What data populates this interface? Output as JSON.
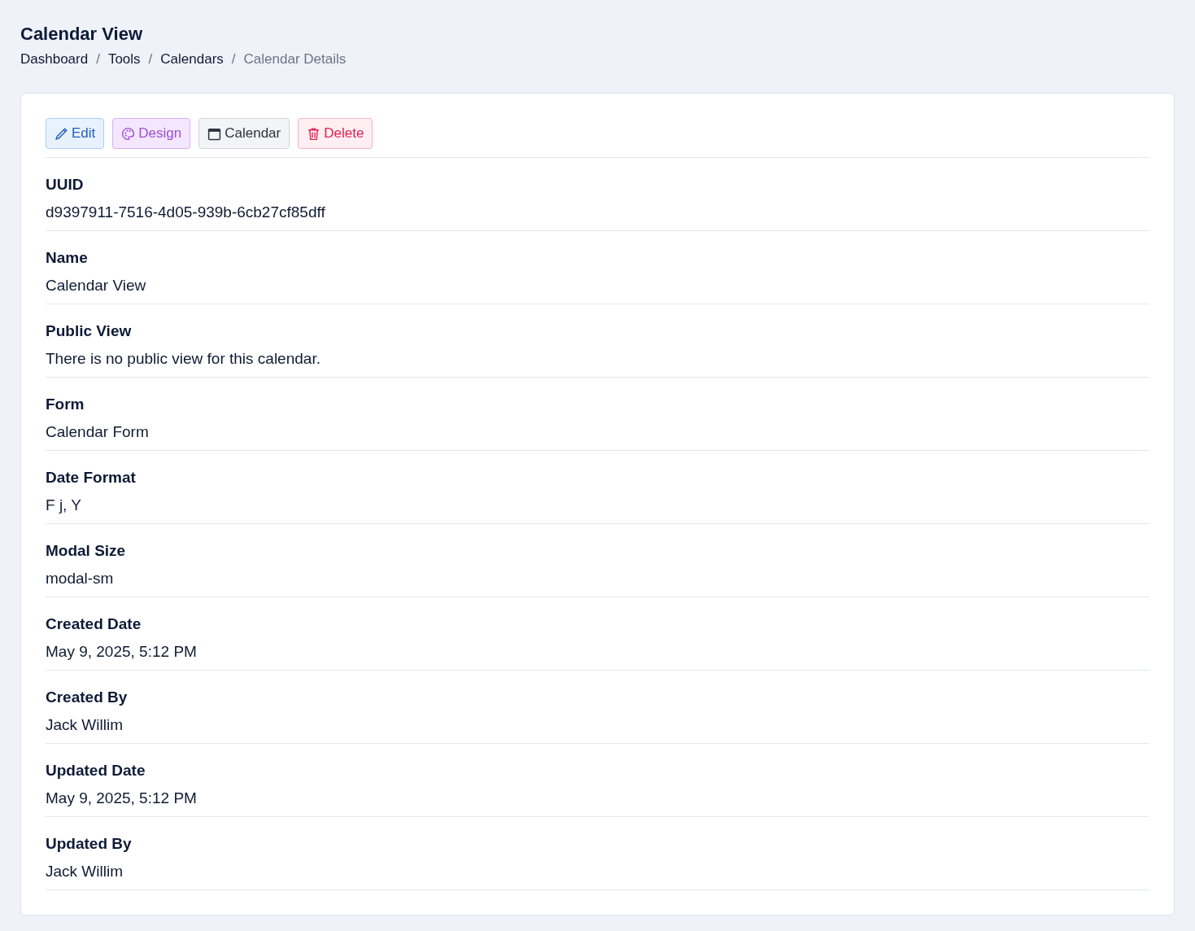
{
  "page_title": "Calendar View",
  "breadcrumb": [
    {
      "label": "Dashboard",
      "current": false
    },
    {
      "separator": "/"
    },
    {
      "label": "Tools",
      "current": false
    },
    {
      "separator": "/"
    },
    {
      "label": "Calendars",
      "current": false
    },
    {
      "separator": "/"
    },
    {
      "label": "Calendar Details",
      "current": true
    }
  ],
  "actions": [
    {
      "kind": "edit",
      "label": "Edit"
    },
    {
      "kind": "design",
      "label": "Design"
    },
    {
      "kind": "calendar",
      "label": "Calendar"
    },
    {
      "kind": "delete",
      "label": "Delete"
    }
  ],
  "fields": [
    {
      "label": "UUID",
      "value": "d9397911-7516-4d05-939b-6cb27cf85dff"
    },
    {
      "label": "Name",
      "value": "Calendar View"
    },
    {
      "label": "Public View",
      "value": "There is no public view for this calendar."
    },
    {
      "label": "Form",
      "value": "Calendar Form"
    },
    {
      "label": "Date Format",
      "value": "F j, Y"
    },
    {
      "label": "Modal Size",
      "value": "modal-sm"
    },
    {
      "label": "Created Date",
      "value": "May 9, 2025, 5:12 PM"
    },
    {
      "label": "Created By",
      "value": "Jack Willim"
    },
    {
      "label": "Updated Date",
      "value": "May 9, 2025, 5:12 PM"
    },
    {
      "label": "Updated By",
      "value": "Jack Willim"
    }
  ]
}
